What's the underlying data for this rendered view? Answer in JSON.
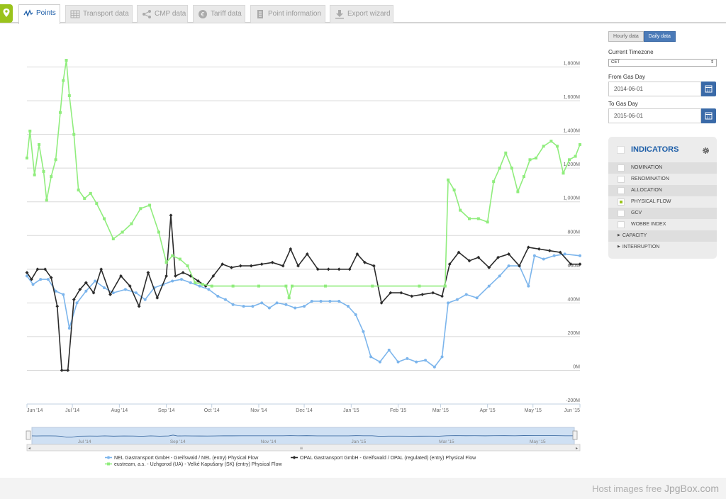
{
  "tabs": [
    {
      "label": "Points",
      "icon": "chart-line-icon",
      "active": true
    },
    {
      "label": "Transport data",
      "icon": "table-grid-icon",
      "active": false
    },
    {
      "label": "CMP data",
      "icon": "share-nodes-icon",
      "active": false
    },
    {
      "label": "Tariff data",
      "icon": "euro-coin-icon",
      "active": false
    },
    {
      "label": "Point information",
      "icon": "document-list-icon",
      "active": false
    },
    {
      "label": "Export wizard",
      "icon": "download-icon",
      "active": false
    }
  ],
  "sidebar": {
    "granularity": {
      "hourly": "Hourly data",
      "daily": "Daily data",
      "selected": "daily"
    },
    "timezone_label": "Current Timezone",
    "timezone_value": "CET",
    "from_label": "From Gas Day",
    "from_value": "2014-06-01",
    "to_label": "To Gas Day",
    "to_value": "2015-06-01",
    "indicators_title": "INDICATORS",
    "indicators": [
      {
        "label": "NOMINATION",
        "checked": false
      },
      {
        "label": "RENOMINATION",
        "checked": false
      },
      {
        "label": "ALLOCATION",
        "checked": false
      },
      {
        "label": "PHYSICAL FLOW",
        "checked": true
      },
      {
        "label": "GCV",
        "checked": false
      },
      {
        "label": "WOBBE INDEX",
        "checked": false
      }
    ],
    "groups": [
      {
        "label": "CAPACITY"
      },
      {
        "label": "INTERRUPTION"
      }
    ]
  },
  "footer": {
    "prefix": "Host images free",
    "brand": "JpgBox.com"
  },
  "colors": {
    "accent": "#1d5ea8",
    "brand_green": "#9ac31c",
    "nel": "#7cb5ec",
    "opal": "#2b2b2b",
    "eustream": "#90ed7d"
  },
  "chart_data": {
    "type": "line",
    "x_ticks": [
      "Jun '14",
      "Jul '14",
      "Aug '14",
      "Sep '14",
      "Oct '14",
      "Nov '14",
      "Dec '14",
      "Jan '15",
      "Feb '15",
      "Mar '15",
      "Apr '15",
      "May '15",
      "Jun '15"
    ],
    "y_ticks": [
      "-200M",
      "0M",
      "200M",
      "400M",
      "600M",
      "800M",
      "1,000M",
      "1,200M",
      "1,400M",
      "1,600M",
      "1,800M"
    ],
    "ylim": [
      -200,
      2000
    ],
    "xlim": [
      "2014-06-01",
      "2015-06-01"
    ],
    "navigator_ticks": [
      "Jul '14",
      "Sep '14",
      "Nov '14",
      "Jan '15",
      "Mar '15",
      "May '15"
    ],
    "legend_position": "bottom",
    "series": [
      {
        "name": "NEL Gastransport GmbH - Greifswald / NEL (entry) Physical Flow",
        "color": "#7cb5ec",
        "points": [
          [
            "2014-06-01",
            560
          ],
          [
            "2014-06-05",
            510
          ],
          [
            "2014-06-10",
            540
          ],
          [
            "2014-06-15",
            540
          ],
          [
            "2014-06-20",
            470
          ],
          [
            "2014-06-25",
            450
          ],
          [
            "2014-06-29",
            250
          ],
          [
            "2014-07-04",
            400
          ],
          [
            "2014-07-10",
            470
          ],
          [
            "2014-07-16",
            530
          ],
          [
            "2014-07-22",
            490
          ],
          [
            "2014-07-28",
            460
          ],
          [
            "2014-08-05",
            480
          ],
          [
            "2014-08-12",
            460
          ],
          [
            "2014-08-18",
            420
          ],
          [
            "2014-08-24",
            490
          ],
          [
            "2014-08-30",
            510
          ],
          [
            "2014-09-05",
            530
          ],
          [
            "2014-09-11",
            540
          ],
          [
            "2014-09-17",
            520
          ],
          [
            "2014-09-23",
            500
          ],
          [
            "2014-09-29",
            480
          ],
          [
            "2014-10-05",
            440
          ],
          [
            "2014-10-10",
            420
          ],
          [
            "2014-10-15",
            390
          ],
          [
            "2014-10-22",
            380
          ],
          [
            "2014-10-28",
            380
          ],
          [
            "2014-11-03",
            400
          ],
          [
            "2014-11-08",
            370
          ],
          [
            "2014-11-13",
            400
          ],
          [
            "2014-11-19",
            390
          ],
          [
            "2014-11-25",
            370
          ],
          [
            "2014-12-01",
            380
          ],
          [
            "2014-12-06",
            410
          ],
          [
            "2014-12-12",
            410
          ],
          [
            "2014-12-18",
            410
          ],
          [
            "2014-12-24",
            410
          ],
          [
            "2014-12-30",
            380
          ],
          [
            "2015-01-04",
            330
          ],
          [
            "2015-01-09",
            230
          ],
          [
            "2015-01-14",
            80
          ],
          [
            "2015-01-20",
            50
          ],
          [
            "2015-01-26",
            120
          ],
          [
            "2015-02-01",
            50
          ],
          [
            "2015-02-07",
            70
          ],
          [
            "2015-02-13",
            50
          ],
          [
            "2015-02-19",
            60
          ],
          [
            "2015-02-25",
            20
          ],
          [
            "2015-03-02",
            80
          ],
          [
            "2015-03-06",
            400
          ],
          [
            "2015-03-12",
            420
          ],
          [
            "2015-03-18",
            450
          ],
          [
            "2015-03-25",
            430
          ],
          [
            "2015-04-02",
            500
          ],
          [
            "2015-04-09",
            560
          ],
          [
            "2015-04-15",
            620
          ],
          [
            "2015-04-22",
            620
          ],
          [
            "2015-04-28",
            500
          ],
          [
            "2015-05-02",
            680
          ],
          [
            "2015-05-08",
            660
          ],
          [
            "2015-05-15",
            680
          ],
          [
            "2015-05-22",
            690
          ],
          [
            "2015-06-01",
            680
          ]
        ]
      },
      {
        "name": "OPAL Gastransport GmbH - Greifswald / OPAL (regulated) (entry) Physical Flow",
        "color": "#2b2b2b",
        "points": [
          [
            "2014-06-01",
            580
          ],
          [
            "2014-06-04",
            540
          ],
          [
            "2014-06-08",
            600
          ],
          [
            "2014-06-13",
            600
          ],
          [
            "2014-06-17",
            550
          ],
          [
            "2014-06-21",
            380
          ],
          [
            "2014-06-24",
            0
          ],
          [
            "2014-06-28",
            0
          ],
          [
            "2014-07-02",
            420
          ],
          [
            "2014-07-06",
            480
          ],
          [
            "2014-07-10",
            520
          ],
          [
            "2014-07-15",
            460
          ],
          [
            "2014-07-20",
            600
          ],
          [
            "2014-07-26",
            450
          ],
          [
            "2014-08-02",
            560
          ],
          [
            "2014-08-08",
            500
          ],
          [
            "2014-08-14",
            380
          ],
          [
            "2014-08-20",
            580
          ],
          [
            "2014-08-26",
            430
          ],
          [
            "2014-09-01",
            560
          ],
          [
            "2014-09-04",
            920
          ],
          [
            "2014-09-07",
            560
          ],
          [
            "2014-09-12",
            580
          ],
          [
            "2014-09-17",
            560
          ],
          [
            "2014-09-22",
            530
          ],
          [
            "2014-09-27",
            500
          ],
          [
            "2014-10-02",
            560
          ],
          [
            "2014-10-08",
            630
          ],
          [
            "2014-10-14",
            610
          ],
          [
            "2014-10-20",
            620
          ],
          [
            "2014-10-27",
            620
          ],
          [
            "2014-11-03",
            630
          ],
          [
            "2014-11-10",
            640
          ],
          [
            "2014-11-17",
            620
          ],
          [
            "2014-11-22",
            720
          ],
          [
            "2014-11-27",
            620
          ],
          [
            "2014-12-03",
            690
          ],
          [
            "2014-12-10",
            600
          ],
          [
            "2014-12-17",
            600
          ],
          [
            "2014-12-24",
            600
          ],
          [
            "2014-12-31",
            600
          ],
          [
            "2015-01-05",
            690
          ],
          [
            "2015-01-10",
            640
          ],
          [
            "2015-01-16",
            620
          ],
          [
            "2015-01-21",
            400
          ],
          [
            "2015-01-27",
            460
          ],
          [
            "2015-02-03",
            460
          ],
          [
            "2015-02-10",
            440
          ],
          [
            "2015-02-17",
            450
          ],
          [
            "2015-02-24",
            460
          ],
          [
            "2015-03-02",
            440
          ],
          [
            "2015-03-07",
            630
          ],
          [
            "2015-03-13",
            700
          ],
          [
            "2015-03-20",
            650
          ],
          [
            "2015-03-26",
            670
          ],
          [
            "2015-04-02",
            610
          ],
          [
            "2015-04-08",
            670
          ],
          [
            "2015-04-15",
            690
          ],
          [
            "2015-04-22",
            620
          ],
          [
            "2015-04-28",
            730
          ],
          [
            "2015-05-05",
            720
          ],
          [
            "2015-05-12",
            710
          ],
          [
            "2015-05-19",
            700
          ],
          [
            "2015-05-26",
            630
          ],
          [
            "2015-06-01",
            630
          ]
        ]
      },
      {
        "name": "eustream, a.s. - Uzhgorod (UA) - Velké Kapušany (SK) (entry) Physical Flow",
        "color": "#90ed7d",
        "points": [
          [
            "2014-06-01",
            1260
          ],
          [
            "2014-06-03",
            1420
          ],
          [
            "2014-06-06",
            1160
          ],
          [
            "2014-06-09",
            1340
          ],
          [
            "2014-06-12",
            1180
          ],
          [
            "2014-06-14",
            1010
          ],
          [
            "2014-06-17",
            1150
          ],
          [
            "2014-06-20",
            1250
          ],
          [
            "2014-06-23",
            1530
          ],
          [
            "2014-06-25",
            1720
          ],
          [
            "2014-06-27",
            1840
          ],
          [
            "2014-06-29",
            1630
          ],
          [
            "2014-07-02",
            1400
          ],
          [
            "2014-07-05",
            1070
          ],
          [
            "2014-07-09",
            1020
          ],
          [
            "2014-07-13",
            1050
          ],
          [
            "2014-07-17",
            990
          ],
          [
            "2014-07-22",
            900
          ],
          [
            "2014-07-28",
            780
          ],
          [
            "2014-08-03",
            820
          ],
          [
            "2014-08-09",
            870
          ],
          [
            "2014-08-15",
            960
          ],
          [
            "2014-08-21",
            980
          ],
          [
            "2014-08-27",
            820
          ],
          [
            "2014-09-01",
            640
          ],
          [
            "2014-09-05",
            680
          ],
          [
            "2014-09-10",
            660
          ],
          [
            "2014-09-15",
            620
          ],
          [
            "2014-09-20",
            520
          ],
          [
            "2014-09-25",
            510
          ],
          [
            "2014-10-01",
            500
          ],
          [
            "2014-10-15",
            500
          ],
          [
            "2014-11-01",
            500
          ],
          [
            "2014-11-19",
            500
          ],
          [
            "2014-11-21",
            430
          ],
          [
            "2014-11-23",
            500
          ],
          [
            "2014-12-15",
            500
          ],
          [
            "2015-01-15",
            500
          ],
          [
            "2015-02-15",
            500
          ],
          [
            "2015-03-04",
            500
          ],
          [
            "2015-03-06",
            1130
          ],
          [
            "2015-03-10",
            1070
          ],
          [
            "2015-03-14",
            950
          ],
          [
            "2015-03-20",
            900
          ],
          [
            "2015-03-26",
            900
          ],
          [
            "2015-04-01",
            880
          ],
          [
            "2015-04-05",
            1120
          ],
          [
            "2015-04-09",
            1200
          ],
          [
            "2015-04-13",
            1290
          ],
          [
            "2015-04-17",
            1200
          ],
          [
            "2015-04-21",
            1060
          ],
          [
            "2015-04-25",
            1150
          ],
          [
            "2015-04-29",
            1250
          ],
          [
            "2015-05-03",
            1260
          ],
          [
            "2015-05-08",
            1330
          ],
          [
            "2015-05-13",
            1360
          ],
          [
            "2015-05-17",
            1330
          ],
          [
            "2015-05-21",
            1170
          ],
          [
            "2015-05-25",
            1250
          ],
          [
            "2015-05-29",
            1270
          ],
          [
            "2015-06-01",
            1340
          ]
        ]
      }
    ]
  }
}
